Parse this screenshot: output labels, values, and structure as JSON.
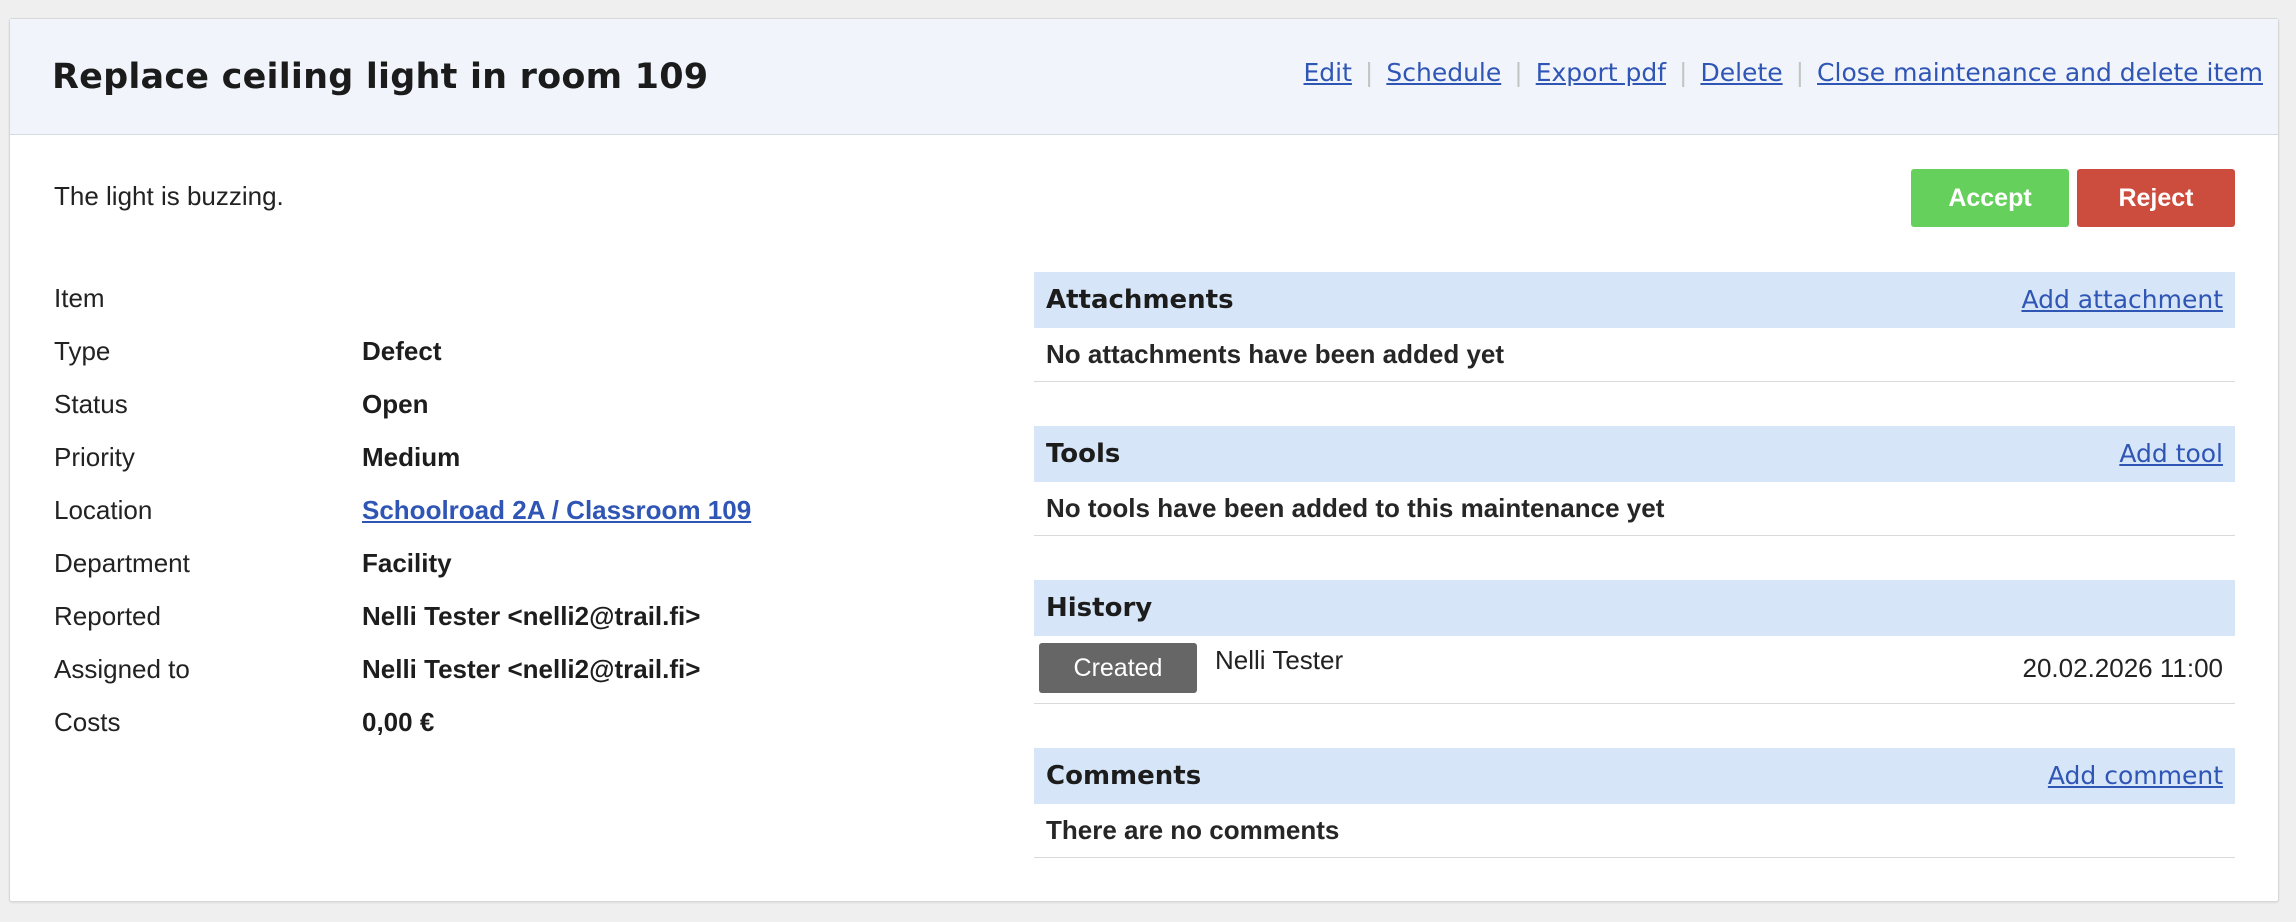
{
  "header": {
    "title": "Replace ceiling light in room 109",
    "actions": {
      "edit": "Edit",
      "schedule": "Schedule",
      "export_pdf": "Export pdf",
      "delete": "Delete",
      "close_and_delete": "Close maintenance and delete item"
    }
  },
  "description": "The light is buzzing.",
  "buttons": {
    "accept": "Accept",
    "reject": "Reject",
    "accept_color": "#66d05c",
    "reject_color": "#cc4d3e"
  },
  "details": {
    "item": {
      "label": "Item",
      "value": ""
    },
    "type": {
      "label": "Type",
      "value": "Defect"
    },
    "status": {
      "label": "Status",
      "value": "Open"
    },
    "priority": {
      "label": "Priority",
      "value": "Medium"
    },
    "location": {
      "label": "Location",
      "value": "Schoolroad 2A / Classroom 109"
    },
    "department": {
      "label": "Department",
      "value": "Facility"
    },
    "reported": {
      "label": "Reported",
      "value": "Nelli Tester <nelli2@trail.fi>"
    },
    "assigned_to": {
      "label": "Assigned to",
      "value": "Nelli Tester <nelli2@trail.fi>"
    },
    "costs": {
      "label": "Costs",
      "value": "0,00 €"
    }
  },
  "attachments": {
    "title": "Attachments",
    "action": "Add attachment",
    "empty": "No attachments have been added yet"
  },
  "tools": {
    "title": "Tools",
    "action": "Add tool",
    "empty": "No tools have been added to this maintenance yet"
  },
  "history": {
    "title": "History",
    "entries": [
      {
        "badge": "Created",
        "user": "Nelli Tester",
        "time": "20.02.2026 11:00"
      }
    ]
  },
  "comments": {
    "title": "Comments",
    "action": "Add comment",
    "empty": "There are no comments"
  }
}
